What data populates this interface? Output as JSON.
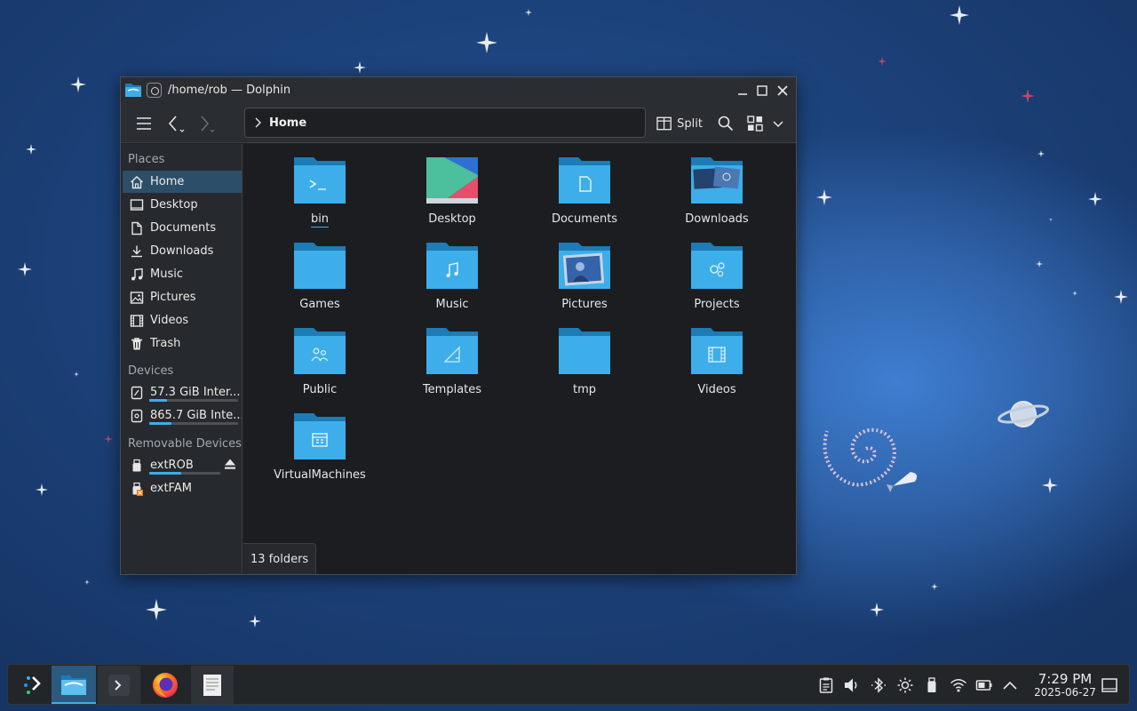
{
  "window": {
    "title": "/home/rob — Dolphin"
  },
  "toolbar": {
    "breadcrumb": "Home",
    "split_label": "Split"
  },
  "sidebar": {
    "places_title": "Places",
    "places": [
      {
        "label": "Home",
        "icon": "home-icon"
      },
      {
        "label": "Desktop",
        "icon": "desktop-icon"
      },
      {
        "label": "Documents",
        "icon": "documents-icon"
      },
      {
        "label": "Downloads",
        "icon": "downloads-icon"
      },
      {
        "label": "Music",
        "icon": "music-icon"
      },
      {
        "label": "Pictures",
        "icon": "pictures-icon"
      },
      {
        "label": "Videos",
        "icon": "videos-icon"
      },
      {
        "label": "Trash",
        "icon": "trash-icon"
      }
    ],
    "devices_title": "Devices",
    "devices": [
      {
        "label": "57.3 GiB Inter...",
        "icon": "drive-icon",
        "usage": 0.2
      },
      {
        "label": "865.7 GiB Inte...",
        "icon": "drive-icon",
        "usage": 0.25
      }
    ],
    "removable_title": "Removable Devices",
    "removable": [
      {
        "label": "extROB",
        "icon": "usb-drive-icon",
        "usage": 0.45
      },
      {
        "label": "extFAM",
        "icon": "usb-drive-error-icon"
      }
    ]
  },
  "folders": [
    {
      "name": "bin",
      "glyph": "terminal"
    },
    {
      "name": "Desktop",
      "glyph": "desktop"
    },
    {
      "name": "Documents",
      "glyph": "document"
    },
    {
      "name": "Downloads",
      "glyph": "downloads-preview"
    },
    {
      "name": "Games",
      "glyph": "none"
    },
    {
      "name": "Music",
      "glyph": "music"
    },
    {
      "name": "Pictures",
      "glyph": "pictures-preview"
    },
    {
      "name": "Projects",
      "glyph": "gears"
    },
    {
      "name": "Public",
      "glyph": "people"
    },
    {
      "name": "Templates",
      "glyph": "template"
    },
    {
      "name": "tmp",
      "glyph": "none"
    },
    {
      "name": "Videos",
      "glyph": "film"
    },
    {
      "name": "VirtualMachines",
      "glyph": "vm"
    }
  ],
  "status": {
    "summary": "13 folders"
  },
  "taskbar": {
    "tasks": [
      "app-launcher-icon",
      "dolphin-icon",
      "terminal-icon",
      "firefox-icon",
      "text-editor-icon"
    ],
    "tray": [
      "clipboard-icon",
      "volume-icon",
      "bluetooth-icon",
      "brightness-icon",
      "usb-icon",
      "wifi-icon",
      "battery-icon",
      "chevron-up-icon"
    ],
    "clock_time": "7:29 PM",
    "clock_date": "2025-06-27"
  },
  "colors": {
    "accent": "#3daee9",
    "folder_body": "#3daee9",
    "folder_tab": "#1d7bb5"
  }
}
